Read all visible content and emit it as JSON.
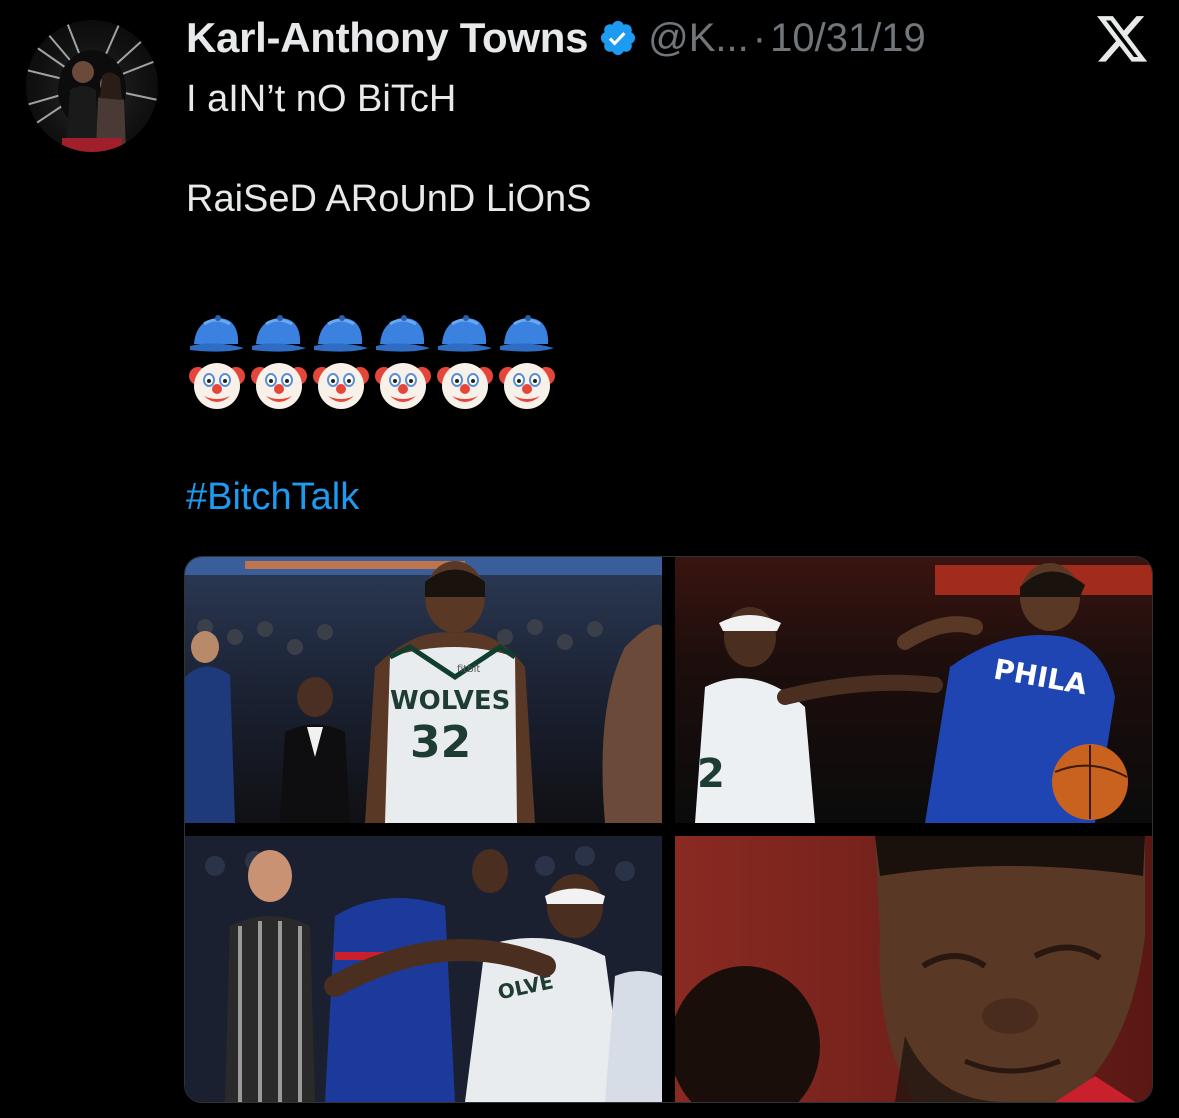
{
  "tweet": {
    "author_name": "Karl-Anthony Towns",
    "handle": "@K...",
    "separator": "·",
    "date": "10/31/19",
    "text_lines": [
      "I aIN’t nO BiTcH",
      "",
      "RaiSeD ARoUnD LiOnS"
    ],
    "emoji_rows": [
      {
        "icon": "blue-cap-icon",
        "count": 6
      },
      {
        "icon": "clown-face-icon",
        "count": 6
      }
    ],
    "hashtag": "#BitchTalk"
  },
  "media": {
    "photos": [
      {
        "name": "photo-towns-wolves-32",
        "jersey_text": "WOLVES",
        "jersey_number": "32",
        "sponsor": "fitbit"
      },
      {
        "name": "photo-embiid-falling",
        "jersey_text": "PHILA"
      },
      {
        "name": "photo-scuffle"
      },
      {
        "name": "photo-embiid-closeup"
      }
    ]
  },
  "icons": {
    "verified": "verified-badge-icon",
    "platform": "x-logo-icon"
  },
  "colors": {
    "background": "#000000",
    "text": "#e7e9ea",
    "secondary_text": "#71767b",
    "link": "#1d9bf0",
    "verified": "#1d9bf0",
    "border": "#2f3336"
  }
}
